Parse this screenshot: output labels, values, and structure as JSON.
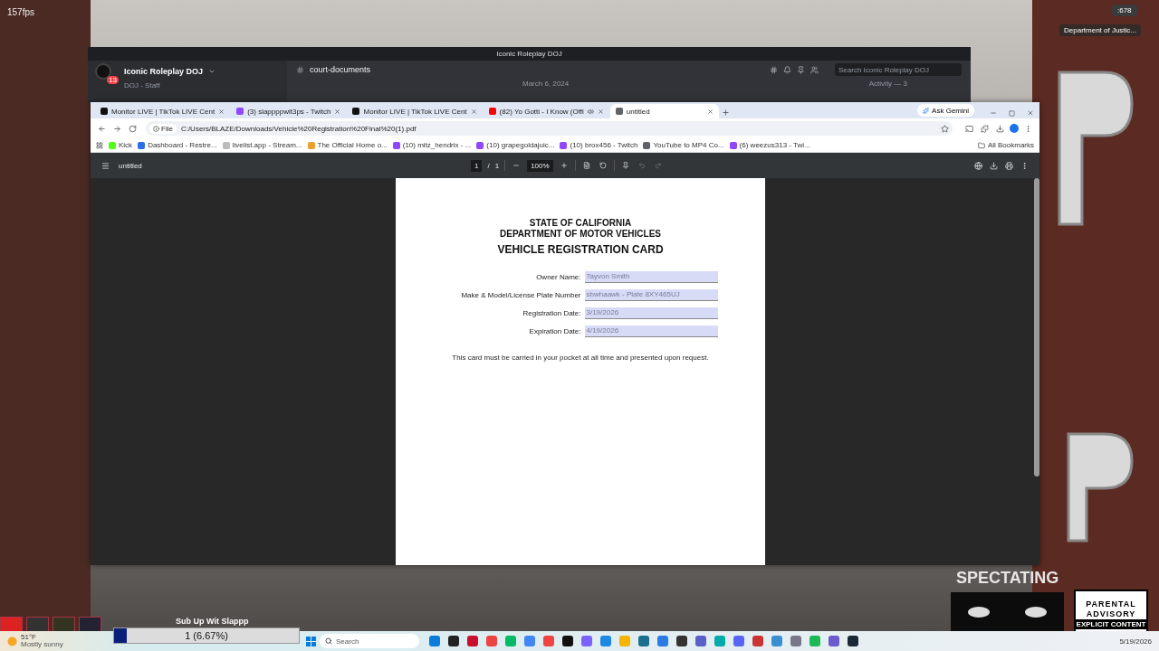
{
  "overlay": {
    "fps": "157fps",
    "counter": ":678",
    "notification": "Department of Justic...",
    "spectating": "SPECTATING",
    "advisory": {
      "top": "PARENTAL",
      "middle": "ADVISORY",
      "bottom": "EXPLICIT CONTENT"
    }
  },
  "sub_goal": {
    "title": "Sub Up Wit Slappp",
    "reading": "1 (6.67%)",
    "level": 0.0667
  },
  "discord": {
    "window_title": "Iconic Roleplay DOJ",
    "unread": "13",
    "server": "Iconic Roleplay DOJ",
    "category": "DOJ - Staff",
    "channel": "court-documents",
    "search": {
      "placeholder": "Search Iconic Roleplay DOJ"
    },
    "date": "March 6, 2024",
    "activity": "Activity — 3"
  },
  "browser": {
    "tabs": [
      {
        "label": "Monitor LIVE | TikTok LIVE Cent",
        "kind": "tiktok",
        "selected": false
      },
      {
        "label": "(3) slappppwit3ps - Twitch",
        "kind": "twitch",
        "selected": false
      },
      {
        "label": "Monitor LIVE | TikTok LIVE Cent",
        "kind": "tiktok",
        "selected": false
      },
      {
        "label": "(82) Yo Gotti - I Know (Offi",
        "kind": "youtube",
        "selected": false
      },
      {
        "label": "untitled",
        "kind": "globe",
        "selected": true
      }
    ],
    "ask_button": "Ask Gemini",
    "file_chip": "File",
    "address": "C:/Users/BLAZE/Downloads/Vehicle%20Registration%20Final%20(1).pdf",
    "bookmarks": [
      {
        "label": "Kick",
        "kind": "kick"
      },
      {
        "label": "Dashboard - Restre...",
        "kind": "restream"
      },
      {
        "label": "livelist.app - Stream...",
        "kind": "plain"
      },
      {
        "label": "The Official Home o...",
        "kind": "home"
      },
      {
        "label": "(10) mitz_hendrix - ...",
        "kind": "twitch"
      },
      {
        "label": "(10) grapegoldajuic...",
        "kind": "twitch"
      },
      {
        "label": "(10) brox456 - Twitch",
        "kind": "twitch"
      },
      {
        "label": "YouTube to MP4 Co...",
        "kind": "globe"
      },
      {
        "label": "(6) weezus313 - Twi...",
        "kind": "twitch"
      }
    ],
    "all_bookmarks": "All Bookmarks"
  },
  "pdf": {
    "title": "untitled",
    "page": "1",
    "separator": "/",
    "total": "1",
    "zoom": "100%"
  },
  "document": {
    "heading": [
      "STATE OF CALIFORNIA",
      "DEPARTMENT OF MOTOR VEHICLES"
    ],
    "title": "VEHICLE REGISTRATION CARD",
    "fields": [
      {
        "label": "Owner Name:",
        "value": "Tayvon Smith"
      },
      {
        "label": "Make & Model/License Plate Number",
        "value": "sbwhaawk - Plate 8XY465UJ"
      },
      {
        "label": "Registration Date:",
        "value": "3/19/2026"
      },
      {
        "label": "Expiration Date:",
        "value": "4/19/2026"
      }
    ],
    "note": "This card must be carried in your pocket at all time and presented upon request."
  },
  "taskbar": {
    "temperature": "51°F",
    "weather": "Mostly sunny",
    "search": {
      "placeholder": "Search"
    },
    "date": "5/19/2026"
  }
}
